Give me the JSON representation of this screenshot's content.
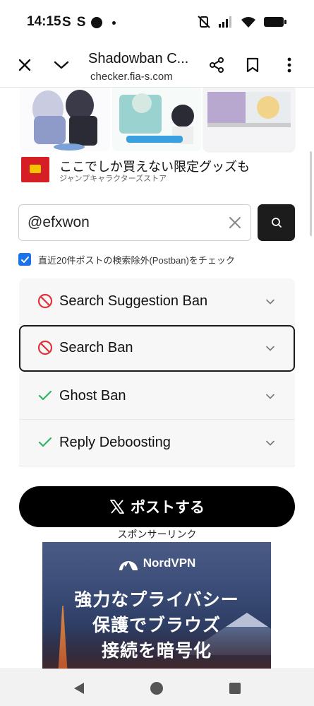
{
  "status_bar": {
    "time": "14:15",
    "notification_glyphs": [
      "S",
      "S"
    ]
  },
  "browser": {
    "title": "Shadowban C...",
    "url": "checker.fia-s.com"
  },
  "top_ad": {
    "headline": "ここでしか買えない限定グッズも",
    "subtext": "ジャンプキャラクターズストア",
    "logo_text": "ジャンプキャラクターズ ストア"
  },
  "search": {
    "value": "@efxwon",
    "placeholder": ""
  },
  "postban_check": {
    "label": "直近20件ポストの検索除外(Postban)をチェック",
    "checked": true
  },
  "ban_checks": [
    {
      "label": "Search Suggestion Ban",
      "status": "banned",
      "icon": "prohibited-icon"
    },
    {
      "label": "Search Ban",
      "status": "banned",
      "icon": "prohibited-icon"
    },
    {
      "label": "Ghost Ban",
      "status": "ok",
      "icon": "check-icon"
    },
    {
      "label": "Reply Deboosting",
      "status": "ok",
      "icon": "check-icon"
    }
  ],
  "post_button": {
    "label": "ポストする"
  },
  "sponsor": {
    "label": "スポンサーリンク"
  },
  "banner_ad": {
    "brand": "NordVPN",
    "lines": [
      "強力なプライバシー",
      "保護でブラウズ",
      "接続を暗号化"
    ]
  },
  "colors": {
    "banned": "#e0333c",
    "ok": "#2fb463",
    "checkbox": "#1a73e8",
    "post_button": "#000000"
  }
}
